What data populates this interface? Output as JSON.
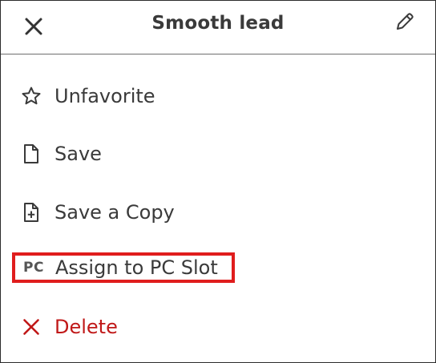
{
  "header": {
    "title": "Smooth lead",
    "close_icon": "close-icon",
    "edit_icon": "pencil-icon"
  },
  "menu": {
    "items": [
      {
        "label": "Unfavorite",
        "icon": "star-outline-icon"
      },
      {
        "label": "Save",
        "icon": "file-icon"
      },
      {
        "label": "Save a Copy",
        "icon": "file-plus-icon"
      },
      {
        "label": "Assign to PC Slot",
        "icon": "pc-icon",
        "icon_text": "PC",
        "highlighted": true
      },
      {
        "label": "Delete",
        "icon": "delete-x-icon"
      }
    ]
  },
  "colors": {
    "text": "#3a3a3a",
    "delete": "#c01818",
    "highlight_border": "#e01d1d",
    "divider": "#6f6f6f"
  }
}
